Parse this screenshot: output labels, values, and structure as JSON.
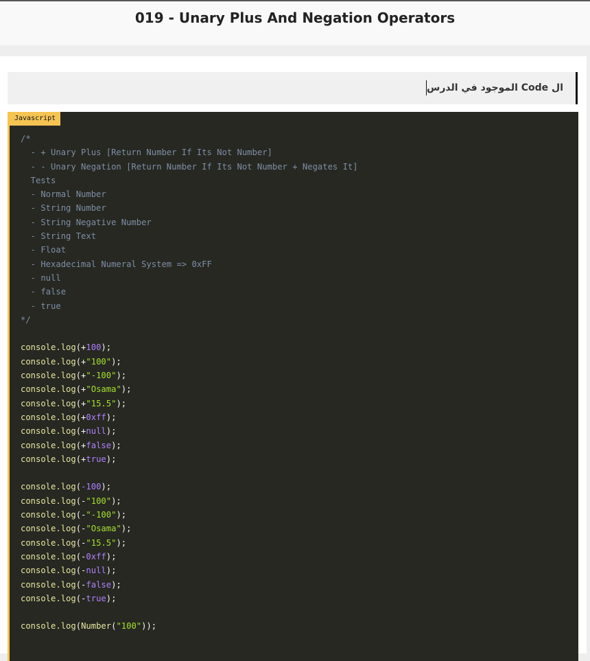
{
  "header": {
    "title": "019 - Unary Plus And Negation Operators"
  },
  "note": {
    "text": "ال Code الموجود في الدرس"
  },
  "code_block": {
    "language": "Javascript",
    "lines": [
      [
        [
          "comment",
          "/*"
        ]
      ],
      [
        [
          "comment",
          "  - + Unary Plus [Return Number If Its Not Number]"
        ]
      ],
      [
        [
          "comment",
          "  - - Unary Negation [Return Number If Its Not Number + Negates It]"
        ]
      ],
      [
        [
          "comment",
          "  Tests"
        ]
      ],
      [
        [
          "comment",
          "  - Normal Number"
        ]
      ],
      [
        [
          "comment",
          "  - String Number"
        ]
      ],
      [
        [
          "comment",
          "  - String Negative Number"
        ]
      ],
      [
        [
          "comment",
          "  - String Text"
        ]
      ],
      [
        [
          "comment",
          "  - Float"
        ]
      ],
      [
        [
          "comment",
          "  - Hexadecimal Numeral System => 0xFF"
        ]
      ],
      [
        [
          "comment",
          "  - null"
        ]
      ],
      [
        [
          "comment",
          "  - false"
        ]
      ],
      [
        [
          "comment",
          "  - true"
        ]
      ],
      [
        [
          "comment",
          "*/"
        ]
      ],
      [],
      [
        [
          "fn",
          "console.log"
        ],
        [
          "punc",
          "(+"
        ],
        [
          "num",
          "100"
        ],
        [
          "punc",
          ");"
        ]
      ],
      [
        [
          "fn",
          "console.log"
        ],
        [
          "punc",
          "(+"
        ],
        [
          "str",
          "\"100\""
        ],
        [
          "punc",
          ");"
        ]
      ],
      [
        [
          "fn",
          "console.log"
        ],
        [
          "punc",
          "(+"
        ],
        [
          "str",
          "\"-100\""
        ],
        [
          "punc",
          ");"
        ]
      ],
      [
        [
          "fn",
          "console.log"
        ],
        [
          "punc",
          "(+"
        ],
        [
          "str",
          "\"Osama\""
        ],
        [
          "punc",
          ");"
        ]
      ],
      [
        [
          "fn",
          "console.log"
        ],
        [
          "punc",
          "(+"
        ],
        [
          "str",
          "\"15.5\""
        ],
        [
          "punc",
          ");"
        ]
      ],
      [
        [
          "fn",
          "console.log"
        ],
        [
          "punc",
          "(+"
        ],
        [
          "num",
          "0xff"
        ],
        [
          "punc",
          ");"
        ]
      ],
      [
        [
          "fn",
          "console.log"
        ],
        [
          "punc",
          "(+"
        ],
        [
          "kw",
          "null"
        ],
        [
          "punc",
          ");"
        ]
      ],
      [
        [
          "fn",
          "console.log"
        ],
        [
          "punc",
          "(+"
        ],
        [
          "kw",
          "false"
        ],
        [
          "punc",
          ");"
        ]
      ],
      [
        [
          "fn",
          "console.log"
        ],
        [
          "punc",
          "(+"
        ],
        [
          "kw",
          "true"
        ],
        [
          "punc",
          ");"
        ]
      ],
      [],
      [
        [
          "fn",
          "console.log"
        ],
        [
          "punc",
          "("
        ],
        [
          "num",
          "-100"
        ],
        [
          "punc",
          ");"
        ]
      ],
      [
        [
          "fn",
          "console.log"
        ],
        [
          "punc",
          "(-"
        ],
        [
          "str",
          "\"100\""
        ],
        [
          "punc",
          ");"
        ]
      ],
      [
        [
          "fn",
          "console.log"
        ],
        [
          "punc",
          "(-"
        ],
        [
          "str",
          "\"-100\""
        ],
        [
          "punc",
          ");"
        ]
      ],
      [
        [
          "fn",
          "console.log"
        ],
        [
          "punc",
          "(-"
        ],
        [
          "str",
          "\"Osama\""
        ],
        [
          "punc",
          ");"
        ]
      ],
      [
        [
          "fn",
          "console.log"
        ],
        [
          "punc",
          "(-"
        ],
        [
          "str",
          "\"15.5\""
        ],
        [
          "punc",
          ");"
        ]
      ],
      [
        [
          "fn",
          "console.log"
        ],
        [
          "punc",
          "(-"
        ],
        [
          "num",
          "0xff"
        ],
        [
          "punc",
          ");"
        ]
      ],
      [
        [
          "fn",
          "console.log"
        ],
        [
          "punc",
          "(-"
        ],
        [
          "kw",
          "null"
        ],
        [
          "punc",
          ");"
        ]
      ],
      [
        [
          "fn",
          "console.log"
        ],
        [
          "punc",
          "(-"
        ],
        [
          "kw",
          "false"
        ],
        [
          "punc",
          ");"
        ]
      ],
      [
        [
          "fn",
          "console.log"
        ],
        [
          "punc",
          "(-"
        ],
        [
          "kw",
          "true"
        ],
        [
          "punc",
          ");"
        ]
      ],
      [],
      [
        [
          "fn",
          "console.log"
        ],
        [
          "punc",
          "("
        ],
        [
          "fn",
          "Number"
        ],
        [
          "punc",
          "("
        ],
        [
          "str",
          "\"100\""
        ],
        [
          "punc",
          "));"
        ]
      ]
    ]
  }
}
